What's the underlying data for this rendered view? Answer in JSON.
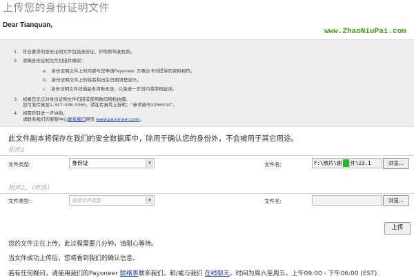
{
  "header": {
    "title": "上传您的身份证明文件",
    "greeting": "Dear Tianquan,",
    "watermark": "www.ZhaoNiuPai.com"
  },
  "instructions": {
    "item1": "1.　符合要求的身份证明文件包括身份证、护照和驾驶执照。",
    "item2": "2.　请确身份证明文件扫描并确保：",
    "sub_a": "a.　身份证明文件上的内容与您申请Payoneer 万事达卡时提供的资料相符。",
    "sub_b": "b.　身份证明文件上的姓名和出生日期清楚显示。",
    "sub_c": "c.　身份证明文件扫描副本清晰无误，以免进一步追问或审核延误。",
    "item3_line1": "3.　如果您无法对身份证明文件扫描或使用数码相机拍摄，",
    "item3_line2": "您可发传真至1-347-438-3365，请在传真件上标明：\"参考编号3266534\"。",
    "item4_line1": "4.　如需获取进一步协助，",
    "item4_pre": "请联系我们的客服中心",
    "item4_link": "联系我们",
    "item4_mid": "网页 ",
    "item4_url": "www.payoneer.com",
    "item4_end": "。"
  },
  "notice": "此文件副本将保存在我们的安全数据库中，除用于确认您的身份外，不会被用于其它用途。",
  "attachment1": {
    "header": "附件1",
    "doc_type_label": "文件类型:",
    "doc_type_value": "身份证",
    "file_name_label": "文件名:",
    "file_name_value": "F:\\照片\\谢   证件\\z3.1",
    "browse_label": "浏览..."
  },
  "attachment2": {
    "header": "附件2．（可选）",
    "doc_type_label": "文件类型:",
    "doc_type_placeholder": "选择文件类型",
    "file_name_label": "文件名:",
    "browse_label": "浏览..."
  },
  "upload_button": "上传",
  "status1": "您的文件正在上传，此过程需要几分钟，请耐心等待。",
  "status2": "当文件成功上传后，您将看到我们的确认信息。",
  "footer": {
    "pre": "若有任何疑问，请使用我们的Payoneer ",
    "link1": "联络表",
    "mid": "联系我们，和/或与我们 ",
    "link2": "在线聊天",
    "post": "，时间为周六至周五，上午09:00 - 下午06:00 (EST)."
  },
  "icons": {
    "dropdown": "chevron-down-icon"
  },
  "colors": {
    "link": "#1a3fa8",
    "watermark": "#3d9a1a",
    "info_bg": "#eeeeee"
  }
}
